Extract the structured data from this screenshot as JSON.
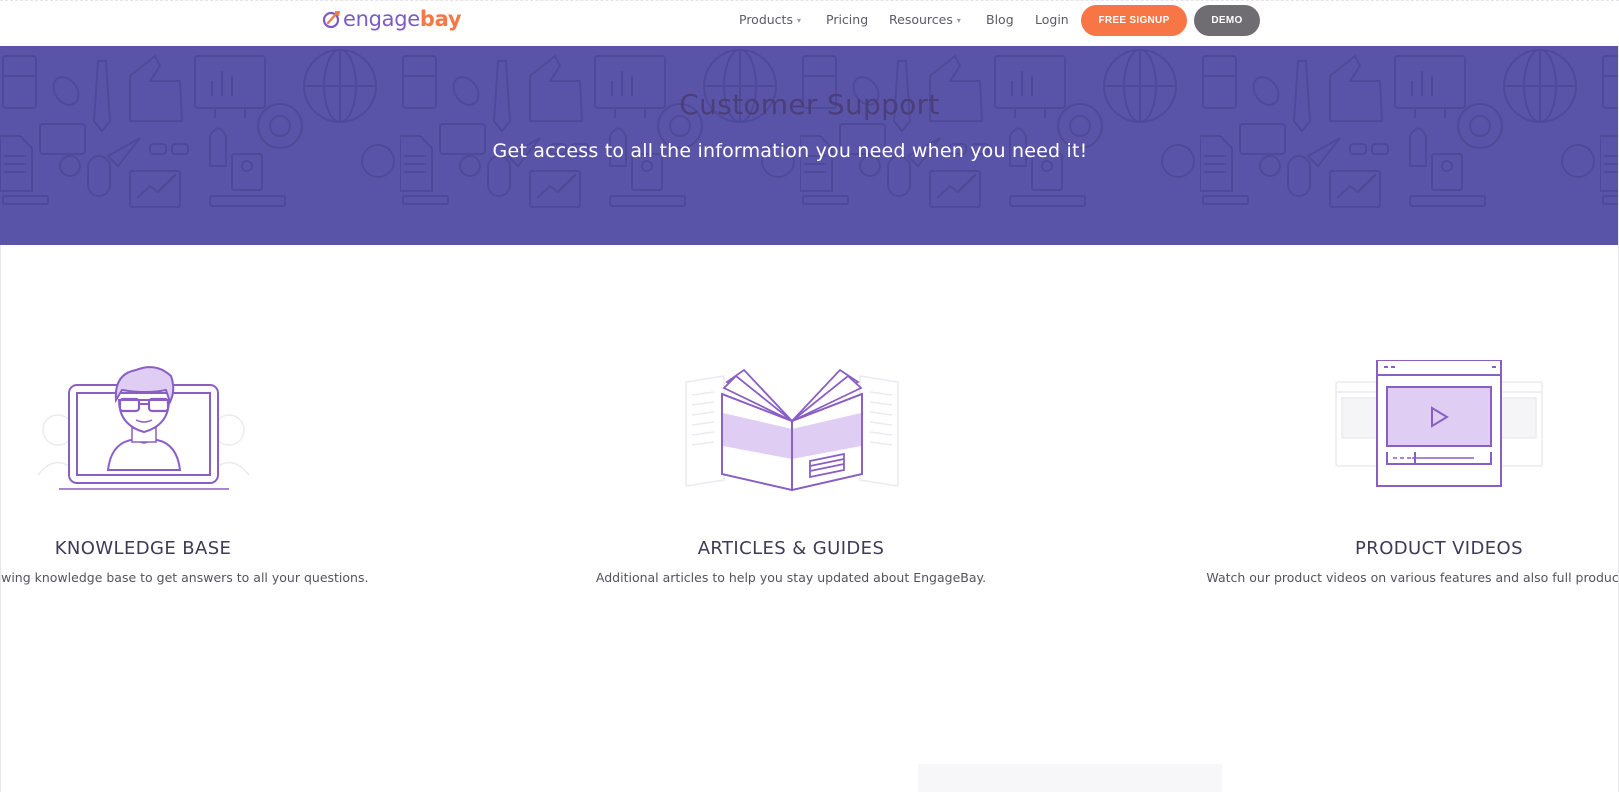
{
  "header": {
    "logo": {
      "part1": "engage",
      "part2": "bay"
    },
    "nav": [
      {
        "label": "Products",
        "has_dropdown": true
      },
      {
        "label": "Pricing",
        "has_dropdown": false
      },
      {
        "label": "Resources",
        "has_dropdown": true
      },
      {
        "label": "Blog",
        "has_dropdown": false
      },
      {
        "label": "Login",
        "has_dropdown": false
      }
    ],
    "signup_label": "FREE SIGNUP",
    "demo_label": "DEMO",
    "caret": "▾"
  },
  "hero": {
    "title": "Customer Support",
    "subtitle": "Get access to all the information you need when you need it!"
  },
  "features": [
    {
      "icon": "person-on-screen-icon",
      "title": "KNOWLEDGE BASE",
      "description": "r growing knowledge base to get answers to all your questions."
    },
    {
      "icon": "open-book-icon",
      "title": "ARTICLES & GUIDES",
      "description": "Additional articles to help you stay updated about EngageBay."
    },
    {
      "icon": "video-player-icon",
      "title": "PRODUCT VIDEOS",
      "description": "Watch our product videos on various features and also full product"
    }
  ],
  "colors": {
    "brand_purple": "#7b5cc7",
    "brand_orange": "#f57845",
    "hero_bg": "#5a54a8",
    "signup_button": "#f87545",
    "demo_button": "#6f6d72",
    "illustration_fill": "#e0cdf3",
    "illustration_stroke": "#8a5fc4"
  }
}
